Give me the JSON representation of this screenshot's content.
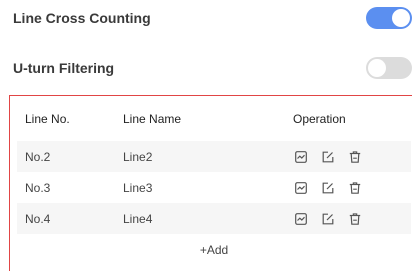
{
  "settings": {
    "line_cross": {
      "label": "Line Cross Counting",
      "state": "on"
    },
    "u_turn": {
      "label": "U-turn Filtering",
      "state": "off"
    }
  },
  "table": {
    "headers": [
      "Line No.",
      "Line Name",
      "Operation"
    ],
    "rows": [
      {
        "no": "No.2",
        "name": "Line2"
      },
      {
        "no": "No.3",
        "name": "Line3"
      },
      {
        "no": "No.4",
        "name": "Line4"
      }
    ],
    "operation_icons": [
      "chart-icon",
      "edit-icon",
      "delete-icon"
    ]
  },
  "add_label": "+Add",
  "colors": {
    "accent": "#5b8ff0",
    "border": "#e14545",
    "toggle_off": "#dcdcdc"
  }
}
